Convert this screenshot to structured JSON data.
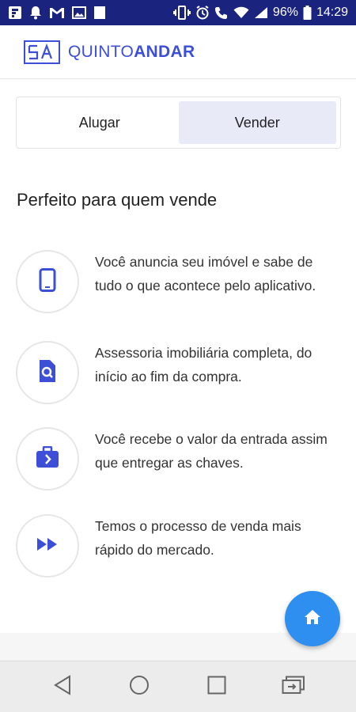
{
  "status_bar": {
    "left_icons": [
      "flipboard-icon",
      "notification-bell-icon",
      "gmail-icon",
      "image-icon",
      "square-icon"
    ],
    "battery_percent": "96%",
    "time": "14:29"
  },
  "header": {
    "logo_mark": "5A",
    "logo_light": "QUINTO",
    "logo_bold": "ANDAR"
  },
  "toggle": {
    "options": [
      {
        "label": "Alugar",
        "selected": false
      },
      {
        "label": "Vender",
        "selected": true
      }
    ]
  },
  "section_title": "Perfeito para quem vende",
  "features": [
    {
      "icon": "smartphone-icon",
      "text": "Você anuncia seu imóvel e sabe de tudo o que acontece pelo aplicativo."
    },
    {
      "icon": "document-search-icon",
      "text": "Assessoria imobiliária completa, do início ao fim da compra."
    },
    {
      "icon": "briefcase-arrow-icon",
      "text": "Você recebe o valor da entrada assim que entregar as chaves."
    },
    {
      "icon": "fast-forward-icon",
      "text": "Temos o processo de venda mais rápido do mercado."
    }
  ],
  "colors": {
    "accent": "#3d4fd6",
    "fab": "#2f8ff0",
    "status_bar": "#1a237e",
    "toggle_selected": "#e8eaf8"
  }
}
